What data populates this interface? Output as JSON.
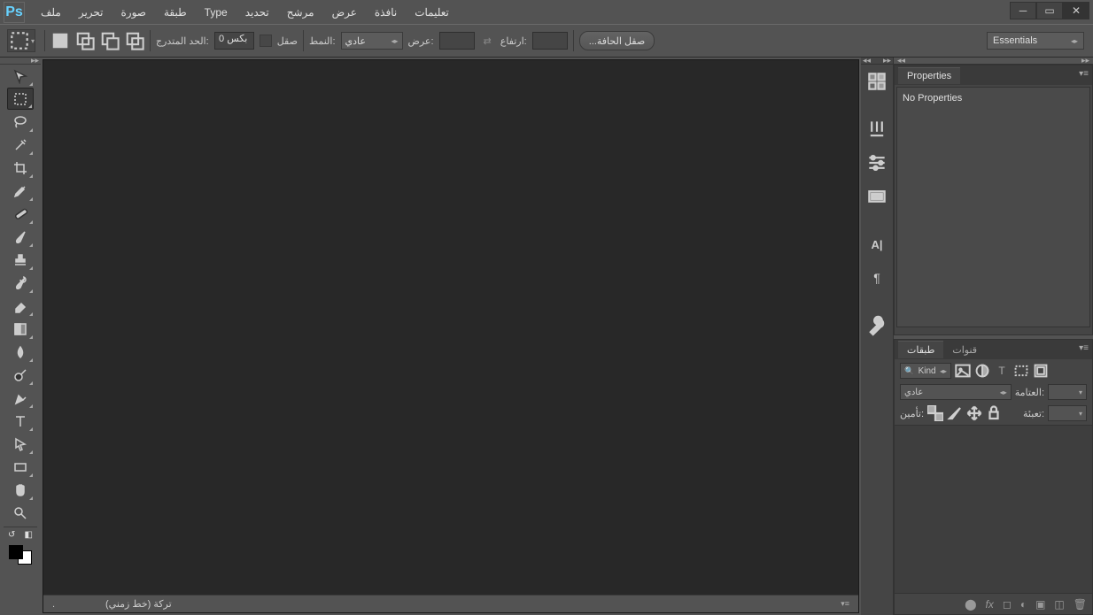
{
  "app": {
    "logo_text": "Ps"
  },
  "menu": {
    "file": "ملف",
    "edit": "تحرير",
    "image": "صورة",
    "layer": "طبقة",
    "type": "Type",
    "select": "تحديد",
    "filter": "مرشح",
    "view": "عرض",
    "window": "نافذة",
    "help": "تعليمات"
  },
  "options": {
    "feather_label": "الحد المتدرج:",
    "feather_value": "0",
    "feather_unit": "بكس",
    "antialias_label": "صقل",
    "style_label": "النمط:",
    "style_value": "عادي",
    "width_label": "عرض:",
    "height_label": "ارتفاع:",
    "refine_edge": "...صقل الحافة"
  },
  "workspace": {
    "current": "Essentials"
  },
  "panels": {
    "properties_tab": "Properties",
    "no_properties": "No Properties",
    "layers_tab": "طبقات",
    "channels_tab": "قنوات",
    "kind_label": "Kind",
    "blend_mode": "عادي",
    "opacity_label": "العتامة:",
    "lock_label": "تأمين:",
    "fill_label": "تعبئة:"
  },
  "status": {
    "timeline": "تركة (خط زمني)"
  }
}
